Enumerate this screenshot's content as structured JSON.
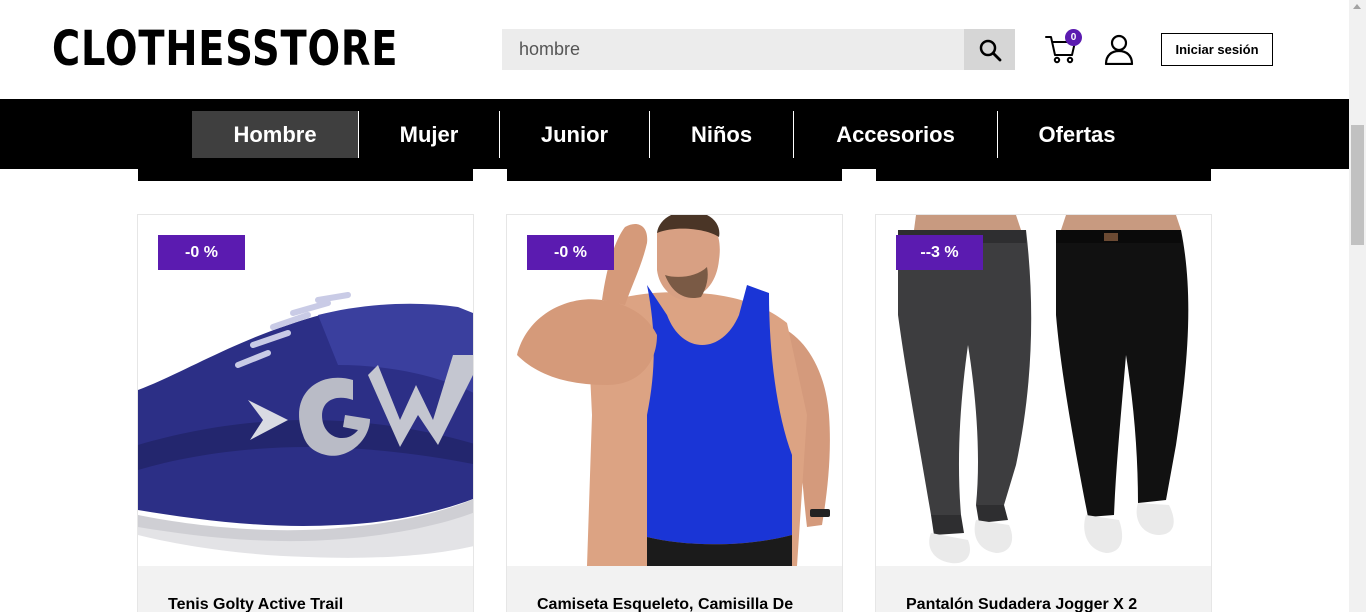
{
  "header": {
    "logo": "CLOTHESSTORE",
    "search_value": "hombre",
    "cart_count": "0",
    "login_label": "Iniciar sesión"
  },
  "nav": {
    "items": [
      {
        "label": "Hombre",
        "active": true
      },
      {
        "label": "Mujer",
        "active": false
      },
      {
        "label": "Junior",
        "active": false
      },
      {
        "label": "Niños",
        "active": false
      },
      {
        "label": "Accesorios",
        "active": false
      },
      {
        "label": "Ofertas",
        "active": false
      }
    ]
  },
  "products": [
    {
      "badge": "-0 %",
      "title": "Tenis Golty Active Trail",
      "image": "blue-running-shoe"
    },
    {
      "badge": "-0 %",
      "title": "Camiseta Esqueleto, Camisilla De",
      "image": "blue-tank-top-model"
    },
    {
      "badge": "--3 %",
      "title": "Pantalón Sudadera Jogger X 2",
      "image": "jogger-pants-pair"
    }
  ],
  "colors": {
    "accent": "#5b1bb0",
    "nav_bg": "#000000",
    "nav_active": "#3f3f3f"
  }
}
